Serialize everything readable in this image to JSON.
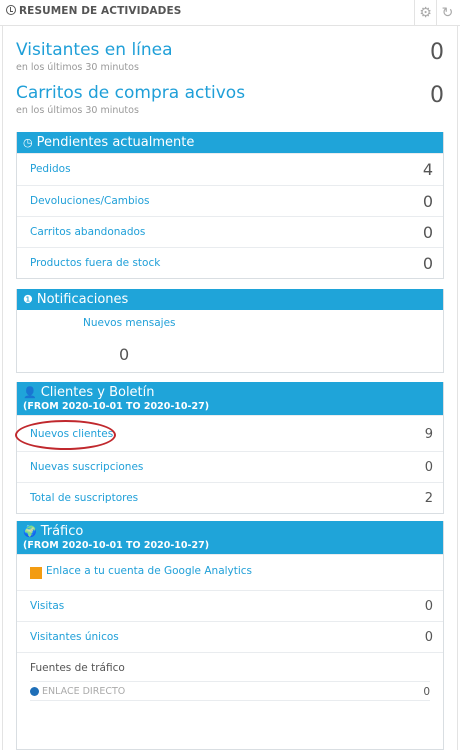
{
  "header": {
    "title": "RESUMEN DE ACTIVIDADES",
    "gear_icon": "gear-icon",
    "refresh_icon": "refresh-icon"
  },
  "visitors": {
    "label": "Visitantes en línea",
    "sub": "en los últimos 30 minutos",
    "value": "0"
  },
  "carts": {
    "label": "Carritos de compra activos",
    "sub": "en los últimos 30 minutos",
    "value": "0"
  },
  "pending": {
    "title": "Pendientes actualmente",
    "icon": "clock-icon",
    "rows": [
      {
        "label": "Pedidos",
        "value": "4"
      },
      {
        "label": "Devoluciones/Cambios",
        "value": "0"
      },
      {
        "label": "Carritos abandonados",
        "value": "0"
      },
      {
        "label": "Productos fuera de stock",
        "value": "0"
      }
    ]
  },
  "notifications": {
    "title": "Notificaciones",
    "icon": "exclamation-icon",
    "item_label": "Nuevos mensajes",
    "item_value": "0"
  },
  "customers": {
    "title": "Clientes y Boletín",
    "subtitle": "(FROM 2020-10-01 TO 2020-10-27)",
    "icon": "user-icon",
    "rows": [
      {
        "label": "Nuevos clientes",
        "value": "9"
      },
      {
        "label": "Nuevas suscripciones",
        "value": "0"
      },
      {
        "label": "Total de suscriptores",
        "value": "2"
      }
    ]
  },
  "traffic": {
    "title": "Tráfico",
    "subtitle": "(FROM 2020-10-01 TO 2020-10-27)",
    "icon": "globe-icon",
    "ga_link": "Enlace a tu cuenta de Google Analytics",
    "rows": [
      {
        "label": "Visitas",
        "value": "0"
      },
      {
        "label": "Visitantes únicos",
        "value": "0"
      }
    ],
    "sources_title": "Fuentes de tráfico",
    "source": {
      "label": "ENLACE DIRECTO",
      "value": "0",
      "color": "#1f6fb8"
    }
  },
  "colors": {
    "accent": "#1fa4d9",
    "link": "#1f9fd8",
    "annotation": "#c0282d"
  }
}
